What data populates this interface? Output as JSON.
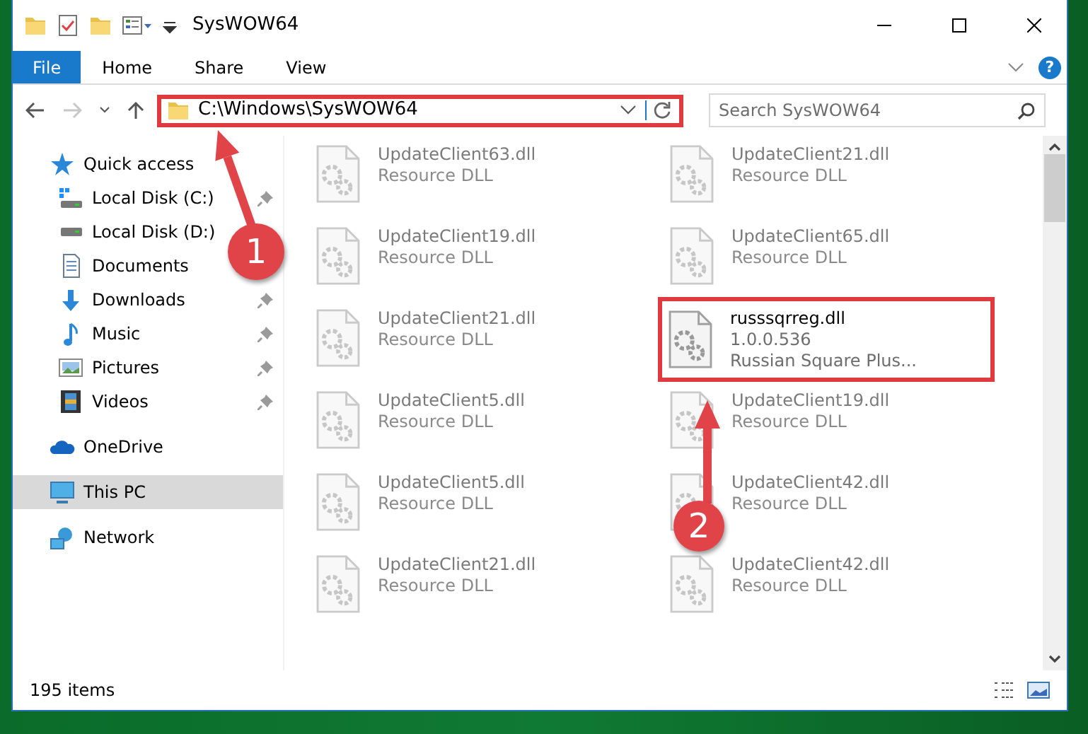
{
  "window": {
    "title": "SysWOW64"
  },
  "ribbon": {
    "tabs": [
      {
        "label": "File",
        "kind": "file",
        "selected": false
      },
      {
        "label": "Home",
        "kind": "tab",
        "selected": false
      },
      {
        "label": "Share",
        "kind": "tab",
        "selected": false
      },
      {
        "label": "View",
        "kind": "tab",
        "selected": false
      }
    ],
    "help": "?"
  },
  "navigation": {
    "forward_disabled": true
  },
  "address": {
    "path": "C:\\Windows\\SysWOW64",
    "boxed": true
  },
  "search": {
    "placeholder": "Search SysWOW64"
  },
  "sidebar": {
    "items": [
      {
        "label": "Quick access",
        "selected": false,
        "children": [
          {
            "label": "Local Disk (C:)",
            "pinned": true,
            "selected": false
          },
          {
            "label": "Local Disk (D:)",
            "pinned": false,
            "selected": false
          },
          {
            "label": "Documents",
            "pinned": false,
            "selected": false
          },
          {
            "label": "Downloads",
            "pinned": true,
            "selected": false
          },
          {
            "label": "Music",
            "pinned": true,
            "selected": false
          },
          {
            "label": "Pictures",
            "pinned": true,
            "selected": false
          },
          {
            "label": "Videos",
            "pinned": true,
            "selected": false
          }
        ]
      },
      {
        "label": "OneDrive",
        "selected": false
      },
      {
        "label": "This PC",
        "selected": true
      },
      {
        "label": "Network",
        "selected": false
      }
    ]
  },
  "files": [
    {
      "name": "UpdateClient63.dll",
      "details": [
        "Resource DLL"
      ],
      "blurred": true,
      "boxed": false
    },
    {
      "name": "UpdateClient21.dll",
      "details": [
        "Resource DLL"
      ],
      "blurred": true,
      "boxed": false
    },
    {
      "name": "UpdateClient19.dll",
      "details": [
        "Resource DLL"
      ],
      "blurred": true,
      "boxed": false
    },
    {
      "name": "UpdateClient65.dll",
      "details": [
        "Resource DLL"
      ],
      "blurred": true,
      "boxed": false
    },
    {
      "name": "UpdateClient21.dll",
      "details": [
        "Resource DLL"
      ],
      "blurred": true,
      "boxed": false
    },
    {
      "name": "russsqrreg.dll",
      "details": [
        "1.0.0.536",
        "Russian Square Plus..."
      ],
      "blurred": false,
      "boxed": true
    },
    {
      "name": "UpdateClient5.dll",
      "details": [
        "Resource DLL"
      ],
      "blurred": true,
      "boxed": false
    },
    {
      "name": "UpdateClient19.dll",
      "details": [
        "Resource DLL"
      ],
      "blurred": true,
      "boxed": false
    },
    {
      "name": "UpdateClient5.dll",
      "details": [
        "Resource DLL"
      ],
      "blurred": true,
      "boxed": false
    },
    {
      "name": "UpdateClient42.dll",
      "details": [
        "Resource DLL"
      ],
      "blurred": true,
      "boxed": false
    },
    {
      "name": "UpdateClient21.dll",
      "details": [
        "Resource DLL"
      ],
      "blurred": true,
      "boxed": false
    },
    {
      "name": "UpdateClient42.dll",
      "details": [
        "Resource DLL"
      ],
      "blurred": true,
      "boxed": false
    }
  ],
  "status_bar": {
    "item_count": "195 items"
  },
  "annotations": [
    {
      "label": "1"
    },
    {
      "label": "2"
    }
  ]
}
